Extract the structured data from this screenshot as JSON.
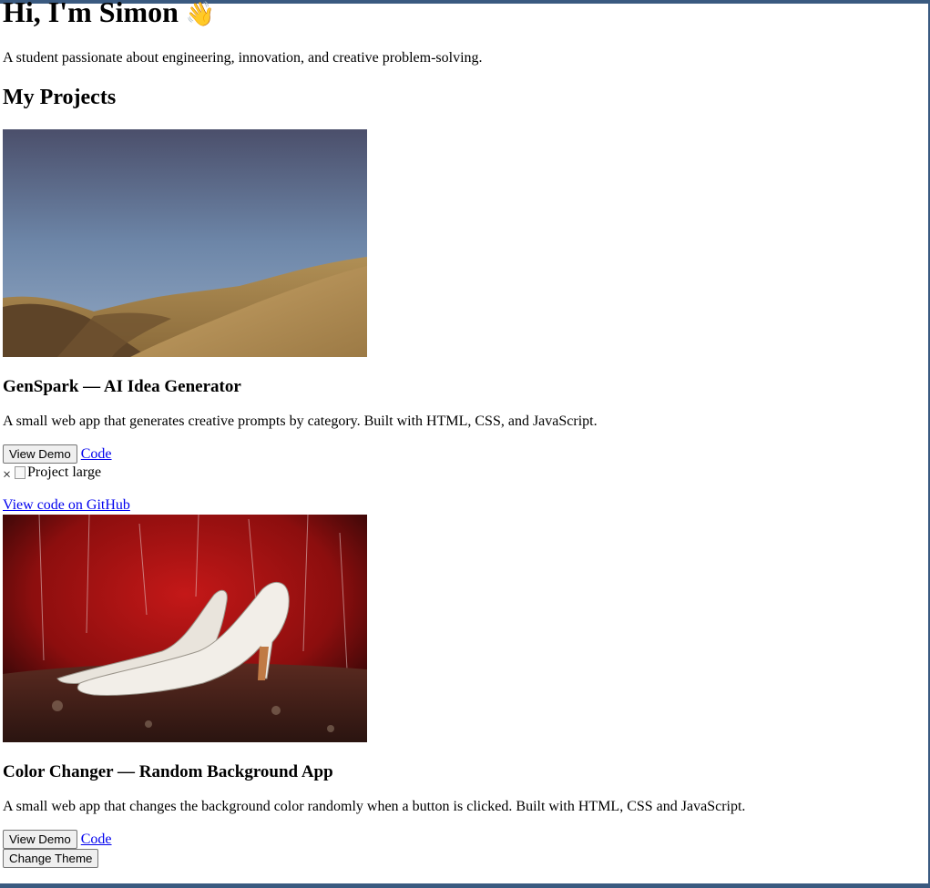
{
  "hero": {
    "title": "Hi, I'm Simon",
    "wave": "👋",
    "intro": "A student passionate about engineering, innovation, and creative problem-solving."
  },
  "projects_heading": "My Projects",
  "projects": [
    {
      "title": "GenSpark — AI Idea Generator",
      "description": "A small web app that generates creative prompts by category. Built with HTML, CSS, and JavaScript.",
      "demo_label": "View Demo",
      "code_label": "Code"
    },
    {
      "title": "Color Changer — Random Background App",
      "description": "A small web app that changes the background color randomly when a button is clicked. Built with HTML, CSS and JavaScript.",
      "demo_label": "View Demo",
      "code_label": "Code"
    }
  ],
  "modal": {
    "close": "×",
    "image_alt": "Project large",
    "github_link": "View code on GitHub"
  },
  "theme_button": "Change Theme"
}
